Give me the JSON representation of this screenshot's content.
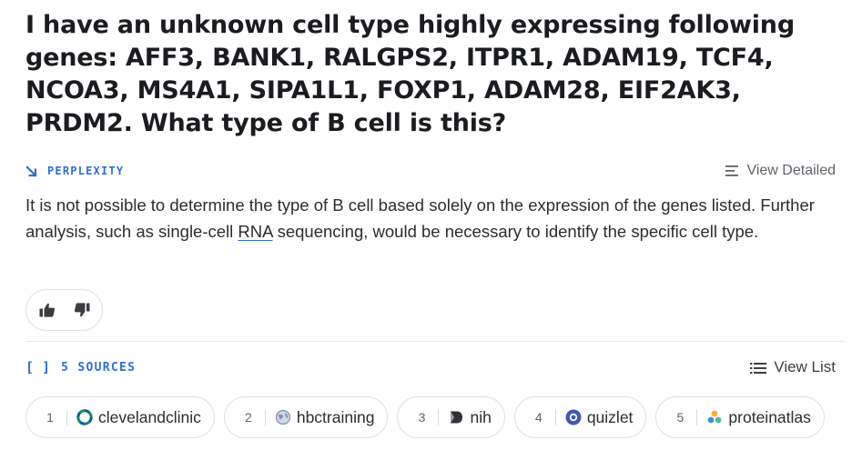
{
  "question": {
    "text": "I have an unknown cell type highly expressing following genes: AFF3, BANK1, RALGPS2, ITPR1, ADAM19, TCF4, NCOA3, MS4A1, SIPA1L1, FOXP1, ADAM28, EIF2AK3, PRDM2. What type of B cell is this?"
  },
  "answer": {
    "brand_label": "PERPLEXITY",
    "brand_icon": "arrow-down-right-icon",
    "view_detailed_label": "View Detailed",
    "text_before_link": "It is not possible to determine the type of B cell based solely on the expression of the genes listed. Further analysis, such as single-cell ",
    "link_text": "RNA",
    "text_after_link": " sequencing, would be necessary to identify the specific cell type."
  },
  "feedback": {
    "icons": [
      "thumbs-up-icon",
      "thumbs-down-icon"
    ]
  },
  "sources": {
    "title": "5 SOURCES",
    "view_list_label": "View List",
    "accent_color": "#2f6fd1",
    "items": [
      {
        "num": "1",
        "name": "clevelandclinic",
        "icon": "clevelandclinic-icon"
      },
      {
        "num": "2",
        "name": "hbctraining",
        "icon": "globe-icon"
      },
      {
        "num": "3",
        "name": "nih",
        "icon": "nih-icon"
      },
      {
        "num": "4",
        "name": "quizlet",
        "icon": "quizlet-icon"
      },
      {
        "num": "5",
        "name": "proteinatlas",
        "icon": "proteinatlas-icon"
      }
    ]
  }
}
